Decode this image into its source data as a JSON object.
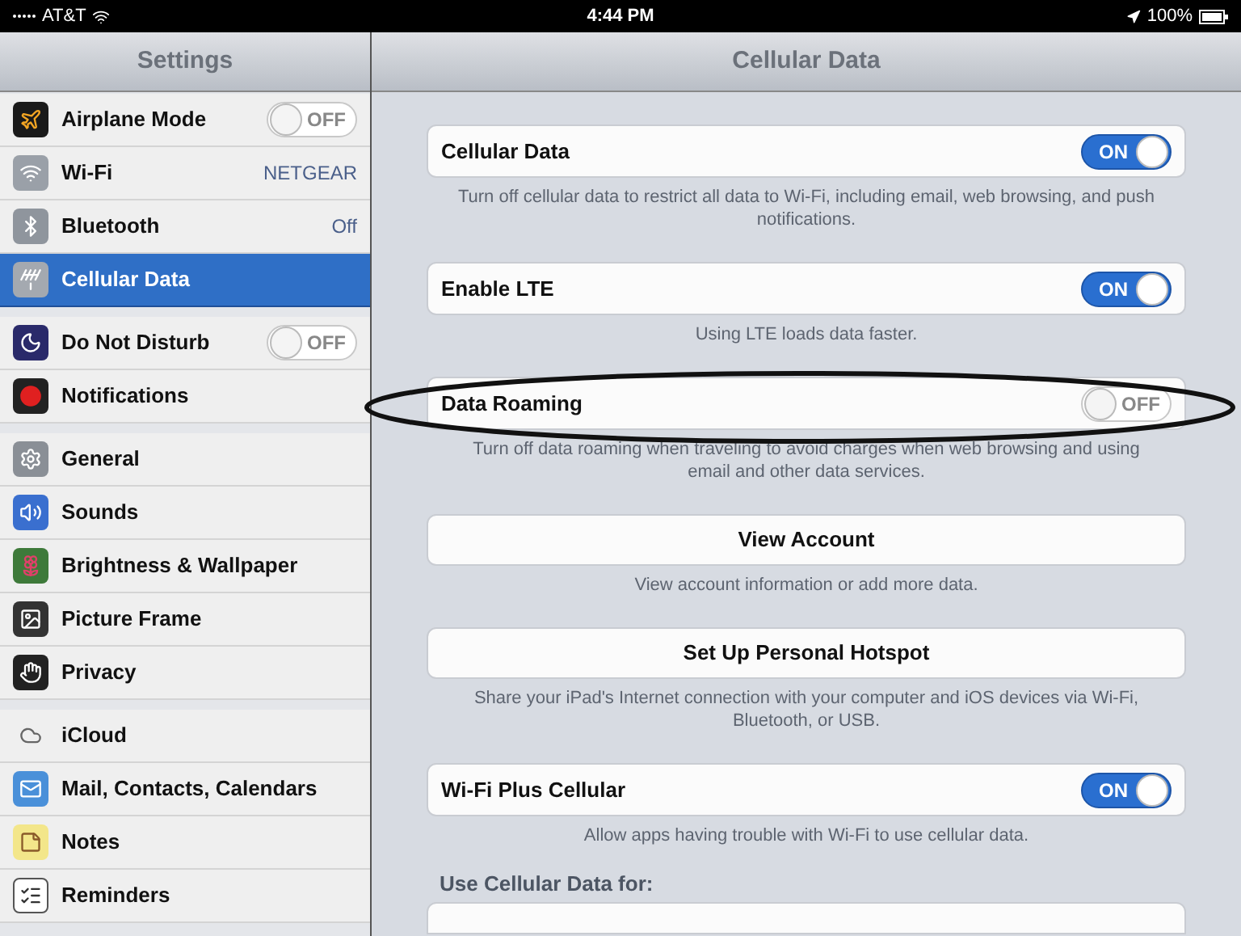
{
  "status_bar": {
    "carrier": "AT&T",
    "time": "4:44 PM",
    "battery": "100%"
  },
  "sidebar": {
    "title": "Settings",
    "groups": [
      {
        "items": [
          {
            "label": "Airplane Mode",
            "kind": "toggle",
            "toggle": {
              "on": false,
              "text": "OFF"
            },
            "selected": false
          },
          {
            "label": "Wi-Fi",
            "kind": "value",
            "value": "NETGEAR",
            "selected": false
          },
          {
            "label": "Bluetooth",
            "kind": "value",
            "value": "Off",
            "selected": false
          },
          {
            "label": "Cellular Data",
            "kind": "plain",
            "selected": true
          }
        ]
      },
      {
        "items": [
          {
            "label": "Do Not Disturb",
            "kind": "toggle",
            "toggle": {
              "on": false,
              "text": "OFF"
            },
            "selected": false
          },
          {
            "label": "Notifications",
            "kind": "plain",
            "selected": false
          }
        ]
      },
      {
        "items": [
          {
            "label": "General",
            "kind": "plain",
            "selected": false
          },
          {
            "label": "Sounds",
            "kind": "plain",
            "selected": false
          },
          {
            "label": "Brightness & Wallpaper",
            "kind": "plain",
            "selected": false
          },
          {
            "label": "Picture Frame",
            "kind": "plain",
            "selected": false
          },
          {
            "label": "Privacy",
            "kind": "plain",
            "selected": false
          }
        ]
      },
      {
        "items": [
          {
            "label": "iCloud",
            "kind": "plain",
            "selected": false
          },
          {
            "label": "Mail, Contacts, Calendars",
            "kind": "plain",
            "selected": false
          },
          {
            "label": "Notes",
            "kind": "plain",
            "selected": false
          },
          {
            "label": "Reminders",
            "kind": "plain",
            "selected": false
          }
        ]
      }
    ]
  },
  "detail": {
    "title": "Cellular Data",
    "sections": [
      {
        "kind": "toggle",
        "label": "Cellular Data",
        "toggle": {
          "on": true,
          "text": "ON"
        },
        "footer": "Turn off cellular data to restrict all data to Wi-Fi, including email, web browsing, and push notifications."
      },
      {
        "kind": "toggle",
        "label": "Enable LTE",
        "toggle": {
          "on": true,
          "text": "ON"
        },
        "footer": "Using LTE loads data faster."
      },
      {
        "kind": "toggle",
        "label": "Data Roaming",
        "toggle": {
          "on": false,
          "text": "OFF"
        },
        "footer": "Turn off data roaming when traveling to avoid charges when web browsing and using email and other data services."
      },
      {
        "kind": "button",
        "label": "View Account",
        "footer": "View account information or add more data."
      },
      {
        "kind": "button",
        "label": "Set Up Personal Hotspot",
        "footer": "Share your iPad's Internet connection with your computer and iOS devices via Wi-Fi, Bluetooth, or USB."
      },
      {
        "kind": "toggle",
        "label": "Wi-Fi Plus Cellular",
        "toggle": {
          "on": true,
          "text": "ON"
        },
        "footer": "Allow apps having trouble with Wi-Fi to use cellular data."
      }
    ],
    "group_header": "Use Cellular Data for:"
  }
}
